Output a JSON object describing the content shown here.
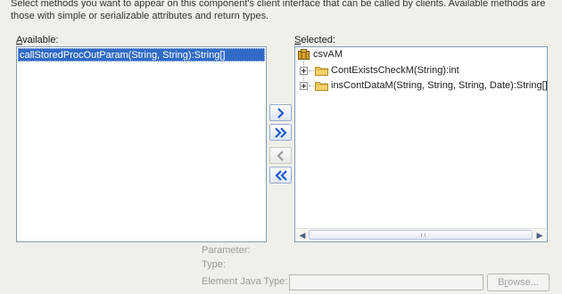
{
  "description": {
    "line1": "Select methods you want to appear on this component's client interface that can be called by clients.  Available methods are",
    "line2": "those with simple or serializable attributes and return types."
  },
  "available": {
    "label_mnemonic": "A",
    "label_rest": "vailable:",
    "items": [
      "callStoredProcOutParam(String, String):String[]"
    ]
  },
  "selected": {
    "label_mnemonic": "S",
    "label_rest": "elected:",
    "root": "csvAM",
    "children": [
      "ContExistsCheckM(String):int",
      "insContDataM(String, String, String, Date):String[]"
    ]
  },
  "buttons": {
    "add": "add-icon",
    "add_all": "add-all-icon",
    "remove": "remove-icon",
    "remove_all": "remove-all-icon"
  },
  "detail": {
    "parameter_label": "Parameter:",
    "type_label": "Type:",
    "element_java_type_label": "Element Java Type:",
    "element_java_type_value": "",
    "browse_mnemonic": "r",
    "browse_before": "B",
    "browse_after": "owse..."
  },
  "colors": {
    "selection": "#316ac5",
    "button_arrow": "#1f5ad0",
    "disabled_text": "#9a9a9a"
  }
}
